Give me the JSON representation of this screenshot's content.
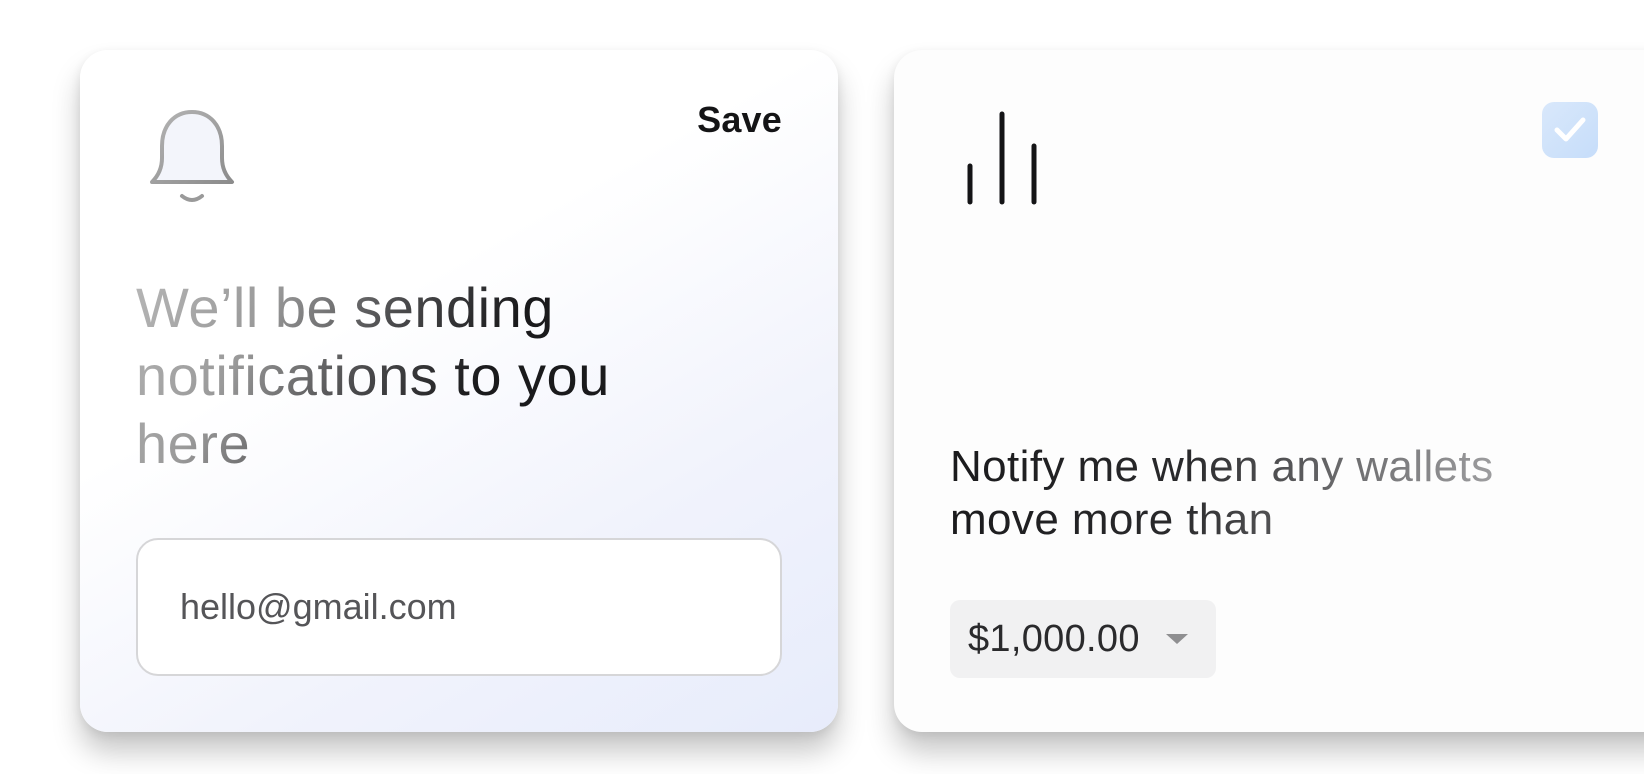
{
  "email_card": {
    "icon": "bell-icon",
    "save_label": "Save",
    "headline": "We’ll be sending notifications to you here",
    "email_value": "hello@gmail.com"
  },
  "alert_card": {
    "icon": "activity-bars-icon",
    "checkbox_checked": true,
    "checkbox_icon": "checkmark-icon",
    "description": "Notify me when any wallets move more than",
    "amount": "$1,000.00",
    "dropdown_icon": "chevron-down-icon"
  },
  "colors": {
    "accent_checkbox": "#cfe2fa",
    "card_gradient_end": "#e7ecfb"
  }
}
